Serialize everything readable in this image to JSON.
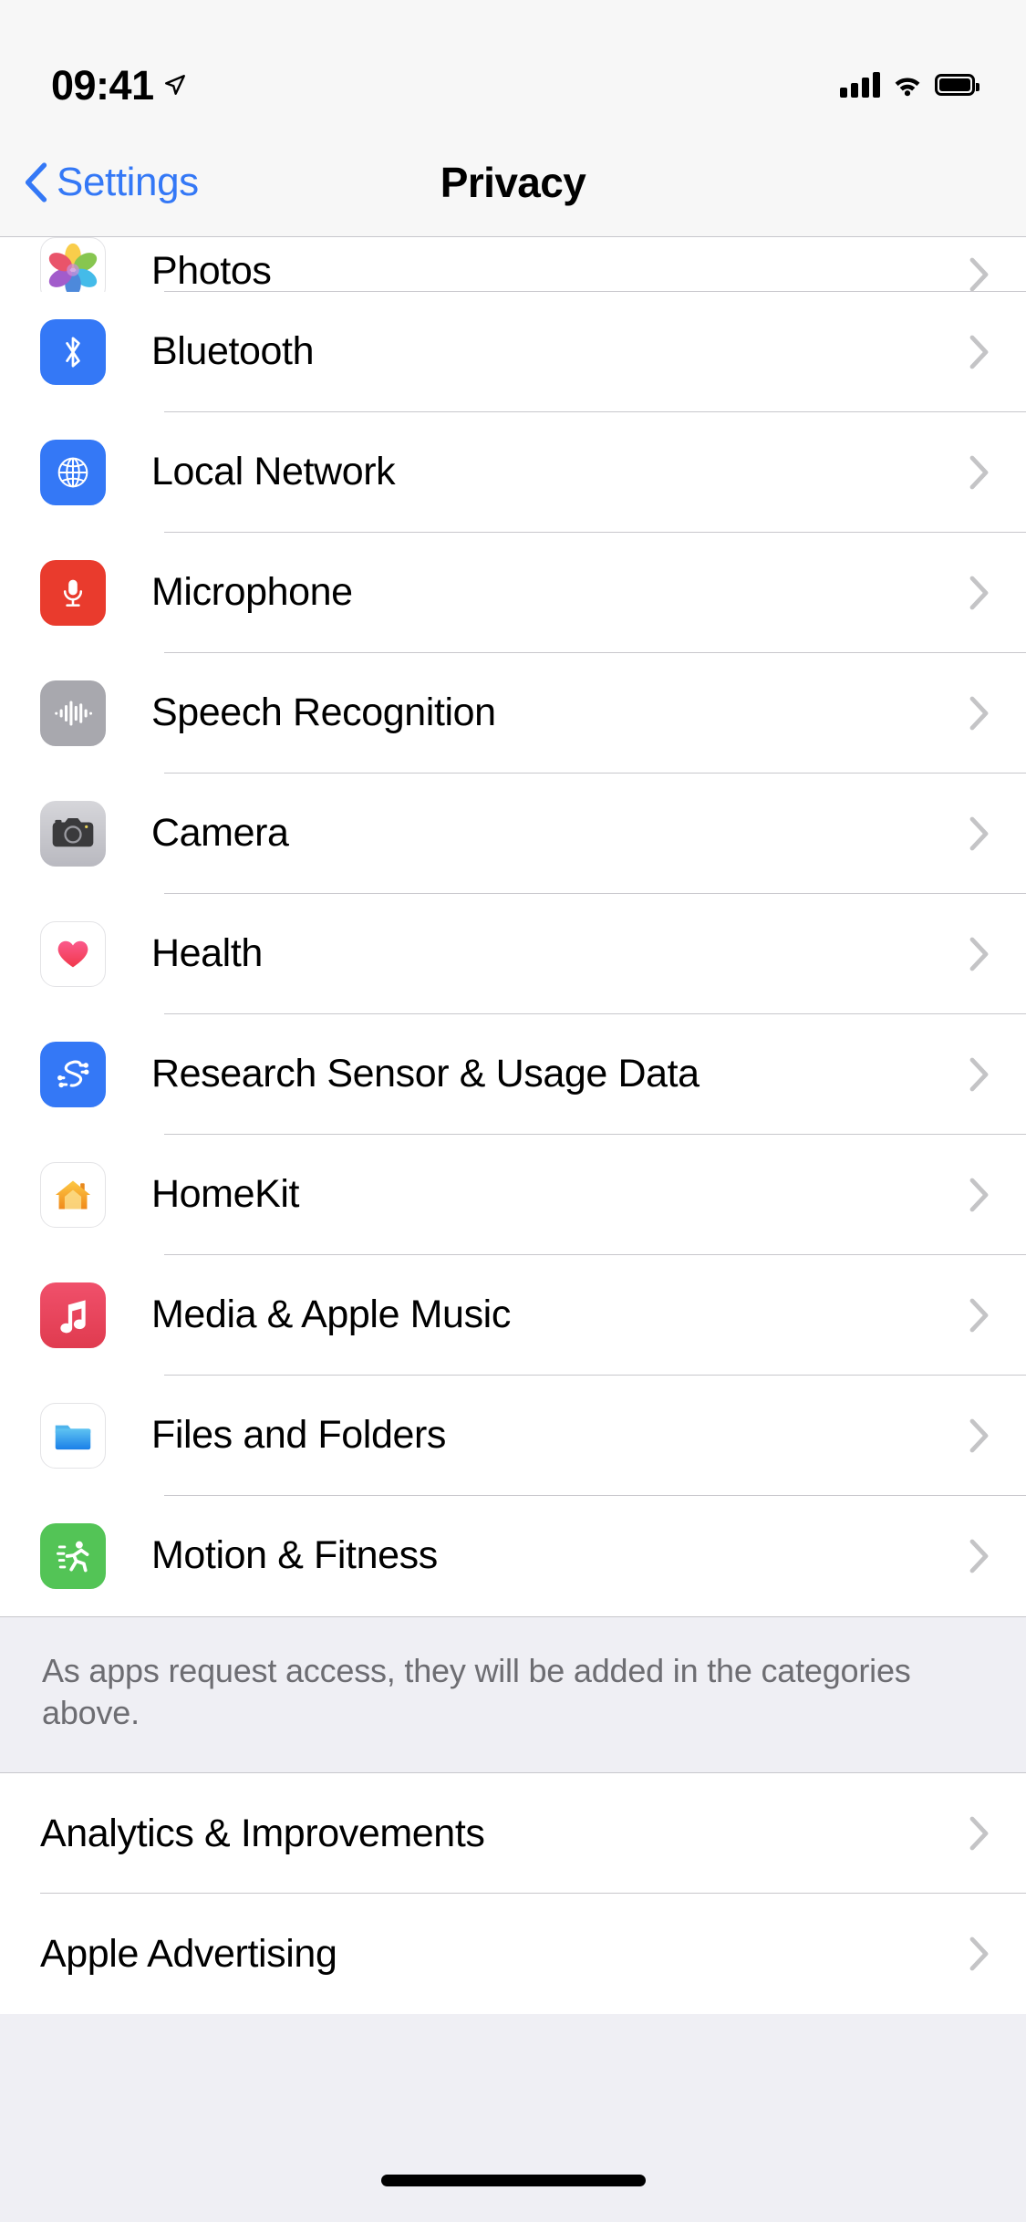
{
  "status_bar": {
    "time": "09:41",
    "location_icon": "location-arrow-icon",
    "cellular_icon": "cellular-bars-icon",
    "wifi_icon": "wifi-icon",
    "battery_icon": "battery-full-icon"
  },
  "nav": {
    "back_label": "Settings",
    "back_icon": "chevron-left-icon",
    "title": "Privacy"
  },
  "colors": {
    "accent_blue": "#3478F6",
    "group_background": "#FFFFFF",
    "page_background": "#EFEFF4",
    "separator": "#C8C7CC",
    "footer_text": "#6D6D72"
  },
  "permissions_group": {
    "items": [
      {
        "label": "Photos",
        "icon": "photos-icon",
        "clipped": true,
        "chevron": "chevron-right-icon"
      },
      {
        "label": "Bluetooth",
        "icon": "bluetooth-icon",
        "chevron": "chevron-right-icon"
      },
      {
        "label": "Local Network",
        "icon": "local-network-globe-icon",
        "chevron": "chevron-right-icon"
      },
      {
        "label": "Microphone",
        "icon": "microphone-icon",
        "chevron": "chevron-right-icon"
      },
      {
        "label": "Speech Recognition",
        "icon": "speech-waveform-icon",
        "chevron": "chevron-right-icon"
      },
      {
        "label": "Camera",
        "icon": "camera-icon",
        "chevron": "chevron-right-icon"
      },
      {
        "label": "Health",
        "icon": "health-heart-icon",
        "chevron": "chevron-right-icon"
      },
      {
        "label": "Research Sensor & Usage Data",
        "icon": "research-sensor-icon",
        "chevron": "chevron-right-icon"
      },
      {
        "label": "HomeKit",
        "icon": "homekit-house-icon",
        "chevron": "chevron-right-icon"
      },
      {
        "label": "Media & Apple Music",
        "icon": "music-note-icon",
        "chevron": "chevron-right-icon"
      },
      {
        "label": "Files and Folders",
        "icon": "files-folder-icon",
        "chevron": "chevron-right-icon"
      },
      {
        "label": "Motion & Fitness",
        "icon": "motion-fitness-icon",
        "chevron": "chevron-right-icon"
      }
    ]
  },
  "footer_note": "As apps request access, they will be added in the categories above.",
  "bottom_group": {
    "items": [
      {
        "label": "Analytics & Improvements",
        "chevron": "chevron-right-icon"
      },
      {
        "label": "Apple Advertising",
        "chevron": "chevron-right-icon"
      }
    ]
  },
  "home_indicator": "home-indicator-bar"
}
